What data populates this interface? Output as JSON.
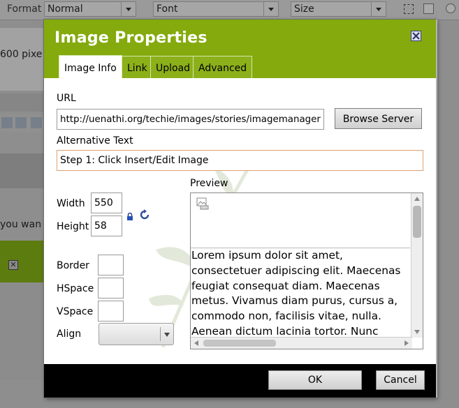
{
  "background": {
    "toolbar": {
      "format_label": "Format",
      "format_value": "Normal",
      "font_value": "Font",
      "size_value": "Size"
    },
    "text_fragment_1": "600 pixe",
    "text_fragment_2": "you wan"
  },
  "dialog": {
    "title": "Image Properties",
    "tabs": [
      {
        "label": "Image Info",
        "active": true
      },
      {
        "label": "Link",
        "active": false
      },
      {
        "label": "Upload",
        "active": false
      },
      {
        "label": "Advanced",
        "active": false
      }
    ],
    "url": {
      "label": "URL",
      "value": "http://uenathi.org/techie/images/stories/imagemanager.png"
    },
    "browse_button": "Browse Server",
    "alt_text": {
      "label": "Alternative Text",
      "value": "Step 1: Click Insert/Edit Image"
    },
    "width": {
      "label": "Width",
      "value": "550"
    },
    "height": {
      "label": "Height",
      "value": "58"
    },
    "border": {
      "label": "Border",
      "value": ""
    },
    "hspace": {
      "label": "HSpace",
      "value": ""
    },
    "vspace": {
      "label": "VSpace",
      "value": ""
    },
    "align": {
      "label": "Align",
      "value": ""
    },
    "preview": {
      "label": "Preview",
      "text": "Lorem ipsum dolor sit amet, consectetuer adipiscing elit. Maecenas feugiat consequat diam. Maecenas metus. Vivamus diam purus, cursus a, commodo non, facilisis vitae, nulla. Aenean dictum lacinia tortor. Nunc iaculis, nibh non iaculis aliquam, orci felis euismod neque, sed ornare massa mauris sed velit."
    },
    "ok_button": "OK",
    "cancel_button": "Cancel"
  },
  "colors": {
    "accent": "#84aa0d",
    "footer": "#000000",
    "focus_border": "#e0a070"
  },
  "icons": {
    "close": "close-icon",
    "lock": "lock-icon",
    "reset": "reset-size-icon",
    "preview_image": "image-placeholder-icon",
    "select_arrow": "chevron-down-icon"
  }
}
